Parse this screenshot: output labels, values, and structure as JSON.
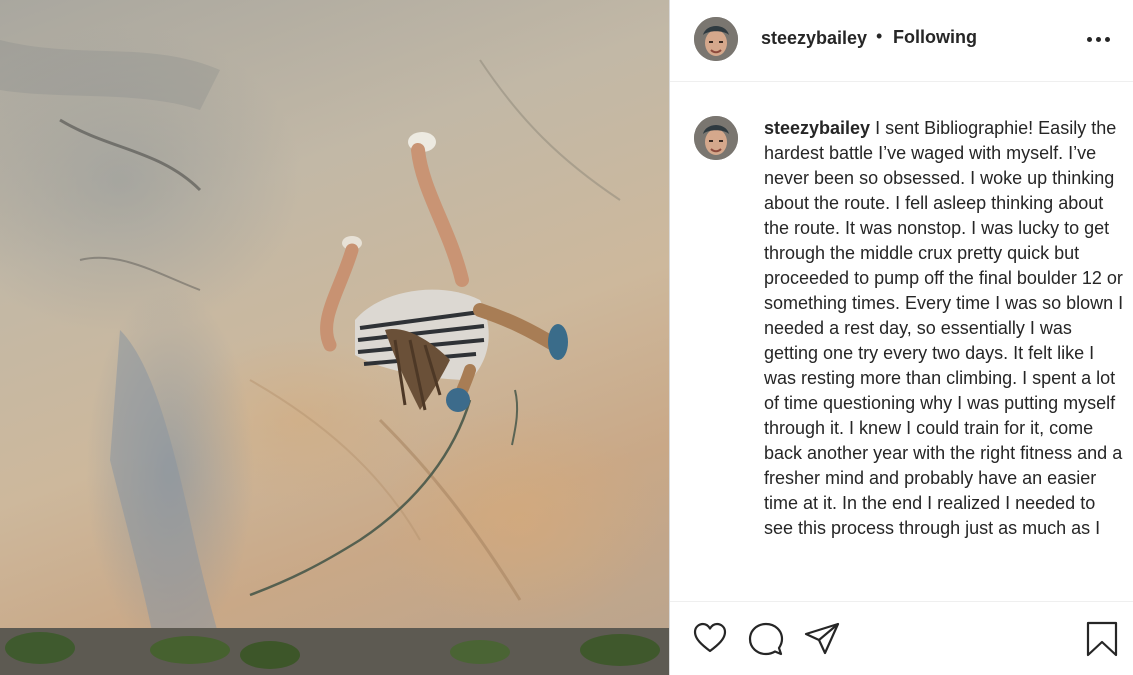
{
  "post": {
    "username": "steezybailey",
    "separator": "•",
    "follow_status": "Following",
    "caption": "I sent Bibliographie! Easily the hardest battle I’ve waged with myself. I’ve never been so obsessed. I woke up thinking about the route. I fell asleep thinking about the route. It was nonstop. I was lucky to get through the middle crux pretty quick but proceeded to pump off the final boulder 12 or something times. Every time I was so blown I needed a rest day, so essentially I was getting one try every two days. It felt like I was resting more than climbing. I spent a lot of time questioning why I was putting myself through it. I knew I could train for it, come back another year with the right fitness and a fresher mind and probably have an easier time at it. In the end I realized I needed to see this process through just as much as I"
  },
  "icons": {
    "more": "more-options-icon",
    "like": "heart-icon",
    "comment": "comment-icon",
    "share": "share-icon",
    "save": "bookmark-icon"
  },
  "colors": {
    "text": "#262626",
    "border": "#dbdbdb",
    "background": "#ffffff"
  }
}
